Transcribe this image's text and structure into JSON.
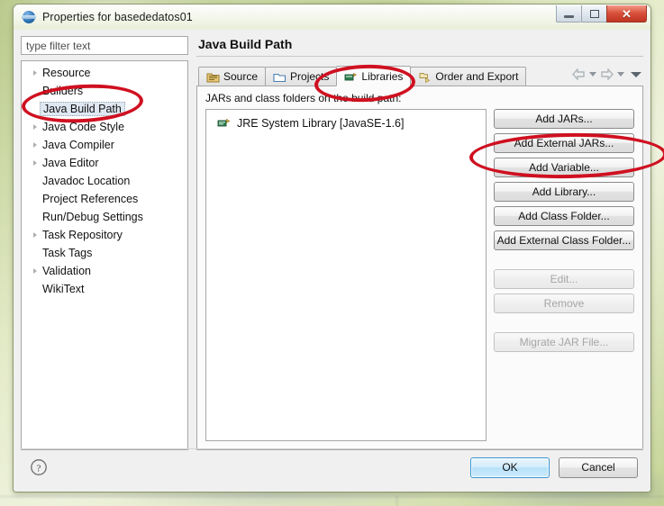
{
  "window": {
    "title": "Properties for basededatos01",
    "app_icon": "eclipse-icon",
    "controls": {
      "minimize": "minimize-button",
      "maximize": "maximize-button",
      "close": "close-button",
      "close_glyph": "✕"
    }
  },
  "sidebar": {
    "filter": {
      "placeholder": "type filter text",
      "value": ""
    },
    "items": [
      {
        "label": "Resource",
        "expandable": true,
        "selected": false
      },
      {
        "label": "Builders",
        "expandable": false,
        "selected": false
      },
      {
        "label": "Java Build Path",
        "expandable": false,
        "selected": true
      },
      {
        "label": "Java Code Style",
        "expandable": true,
        "selected": false
      },
      {
        "label": "Java Compiler",
        "expandable": true,
        "selected": false
      },
      {
        "label": "Java Editor",
        "expandable": true,
        "selected": false
      },
      {
        "label": "Javadoc Location",
        "expandable": false,
        "selected": false
      },
      {
        "label": "Project References",
        "expandable": false,
        "selected": false
      },
      {
        "label": "Run/Debug Settings",
        "expandable": false,
        "selected": false
      },
      {
        "label": "Task Repository",
        "expandable": true,
        "selected": false
      },
      {
        "label": "Task Tags",
        "expandable": false,
        "selected": false
      },
      {
        "label": "Validation",
        "expandable": true,
        "selected": false
      },
      {
        "label": "WikiText",
        "expandable": false,
        "selected": false
      }
    ]
  },
  "main": {
    "page_title": "Java Build Path",
    "nav": {
      "back": "back-arrow-icon",
      "back_menu": "chevron-down-icon",
      "forward": "forward-arrow-icon",
      "forward_menu": "chevron-down-icon",
      "view_menu": "view-menu-icon"
    },
    "tabs": [
      {
        "label": "Source",
        "icon": "source-folder-icon",
        "active": false
      },
      {
        "label": "Projects",
        "icon": "projects-folder-icon",
        "active": false
      },
      {
        "label": "Libraries",
        "icon": "libraries-icon",
        "active": true
      },
      {
        "label": "Order and Export",
        "icon": "order-export-icon",
        "active": false
      }
    ],
    "panel_label": "JARs and class folders on the build path:",
    "list_items": [
      {
        "label": "JRE System Library [JavaSE-1.6]",
        "icon": "jre-library-icon"
      }
    ],
    "buttons": [
      {
        "label": "Add JARs...",
        "enabled": true,
        "group": 1
      },
      {
        "label": "Add External JARs...",
        "enabled": true,
        "group": 1
      },
      {
        "label": "Add Variable...",
        "enabled": true,
        "group": 1
      },
      {
        "label": "Add Library...",
        "enabled": true,
        "group": 1
      },
      {
        "label": "Add Class Folder...",
        "enabled": true,
        "group": 1
      },
      {
        "label": "Add External Class Folder...",
        "enabled": true,
        "group": 1
      },
      {
        "label": "Edit...",
        "enabled": false,
        "group": 2
      },
      {
        "label": "Remove",
        "enabled": false,
        "group": 2
      },
      {
        "label": "Migrate JAR File...",
        "enabled": false,
        "group": 3
      }
    ]
  },
  "footer": {
    "help_icon": "help-question-icon",
    "ok_label": "OK",
    "cancel_label": "Cancel"
  },
  "annotations": {
    "color": "#cf1020",
    "marks": [
      {
        "target": "Libraries tab"
      },
      {
        "target": "Java Build Path sidebar item"
      },
      {
        "target": "Add External JARs... button"
      }
    ]
  }
}
